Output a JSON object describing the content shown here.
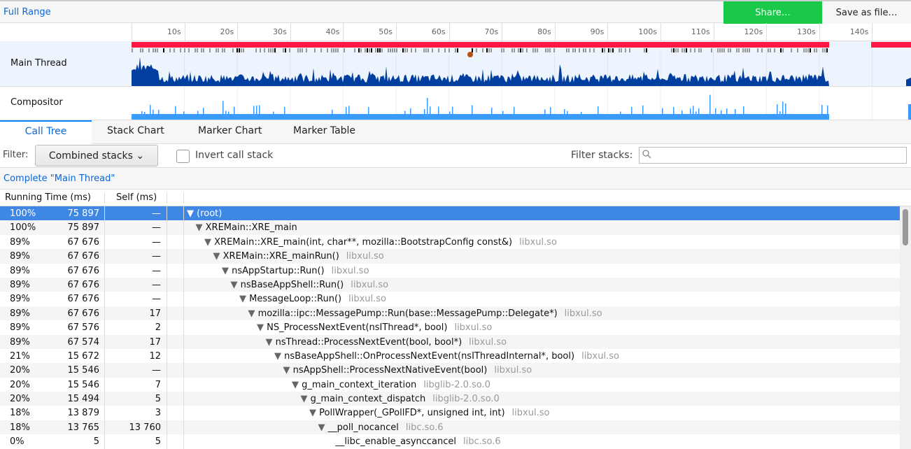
{
  "topbar": {
    "full_range": "Full Range",
    "share": "Share…",
    "save": "Save as file…"
  },
  "timeline": {
    "ticks": [
      "10s",
      "20s",
      "30s",
      "40s",
      "50s",
      "60s",
      "70s",
      "80s",
      "90s",
      "100s",
      "110s",
      "120s",
      "130s",
      "140s"
    ],
    "tracks": [
      {
        "label": "Main Thread"
      },
      {
        "label": "Compositor"
      }
    ]
  },
  "colors": {
    "accent": "#0a84ff",
    "share": "#1bc94a",
    "selected_row": "#3f87e5",
    "cpu_graph": "#003ea0",
    "compositor_graph": "#3b9cff",
    "markers": "#ff1744"
  },
  "tabs": [
    "Call Tree",
    "Stack Chart",
    "Marker Chart",
    "Marker Table"
  ],
  "filter": {
    "label": "Filter:",
    "select": "Combined stacks",
    "invert": "Invert call stack",
    "invert_checked": false,
    "filter_stacks_label": "Filter stacks:",
    "filter_stacks_value": ""
  },
  "breadcrumb": "Complete \"Main Thread\"",
  "columns": {
    "running": "Running Time (ms)",
    "self": "Self (ms)"
  },
  "rows": [
    {
      "pct": "100%",
      "ms": "75 897",
      "self": "—",
      "name": "(root)",
      "lib": "",
      "depth": 0,
      "open": true
    },
    {
      "pct": "100%",
      "ms": "75 897",
      "self": "—",
      "name": "XREMain::XRE_main",
      "lib": "",
      "depth": 1,
      "open": true
    },
    {
      "pct": "89%",
      "ms": "67 676",
      "self": "—",
      "name": "XREMain::XRE_main(int, char**, mozilla::BootstrapConfig const&)",
      "lib": "libxul.so",
      "depth": 2,
      "open": true
    },
    {
      "pct": "89%",
      "ms": "67 676",
      "self": "—",
      "name": "XREMain::XRE_mainRun()",
      "lib": "libxul.so",
      "depth": 3,
      "open": true
    },
    {
      "pct": "89%",
      "ms": "67 676",
      "self": "—",
      "name": "nsAppStartup::Run()",
      "lib": "libxul.so",
      "depth": 4,
      "open": true
    },
    {
      "pct": "89%",
      "ms": "67 676",
      "self": "—",
      "name": "nsBaseAppShell::Run()",
      "lib": "libxul.so",
      "depth": 5,
      "open": true
    },
    {
      "pct": "89%",
      "ms": "67 676",
      "self": "—",
      "name": "MessageLoop::Run()",
      "lib": "libxul.so",
      "depth": 6,
      "open": true
    },
    {
      "pct": "89%",
      "ms": "67 676",
      "self": "17",
      "name": "mozilla::ipc::MessagePump::Run(base::MessagePump::Delegate*)",
      "lib": "libxul.so",
      "depth": 7,
      "open": true
    },
    {
      "pct": "89%",
      "ms": "67 576",
      "self": "2",
      "name": "NS_ProcessNextEvent(nsIThread*, bool)",
      "lib": "libxul.so",
      "depth": 8,
      "open": true
    },
    {
      "pct": "89%",
      "ms": "67 574",
      "self": "17",
      "name": "nsThread::ProcessNextEvent(bool, bool*)",
      "lib": "libxul.so",
      "depth": 9,
      "open": true
    },
    {
      "pct": "21%",
      "ms": "15 672",
      "self": "12",
      "name": "nsBaseAppShell::OnProcessNextEvent(nsIThreadInternal*, bool)",
      "lib": "libxul.so",
      "depth": 10,
      "open": true
    },
    {
      "pct": "20%",
      "ms": "15 546",
      "self": "—",
      "name": "nsAppShell::ProcessNextNativeEvent(bool)",
      "lib": "libxul.so",
      "depth": 11,
      "open": true
    },
    {
      "pct": "20%",
      "ms": "15 546",
      "self": "7",
      "name": "g_main_context_iteration",
      "lib": "libglib-2.0.so.0",
      "depth": 12,
      "open": true
    },
    {
      "pct": "20%",
      "ms": "15 494",
      "self": "5",
      "name": "g_main_context_dispatch",
      "lib": "libglib-2.0.so.0",
      "depth": 13,
      "open": true
    },
    {
      "pct": "18%",
      "ms": "13 879",
      "self": "3",
      "name": "PollWrapper(_GPollFD*, unsigned int, int)",
      "lib": "libxul.so",
      "depth": 14,
      "open": true
    },
    {
      "pct": "18%",
      "ms": "13 765",
      "self": "13 760",
      "name": "__poll_nocancel",
      "lib": "libc.so.6",
      "depth": 15,
      "open": true
    },
    {
      "pct": "0%",
      "ms": "5",
      "self": "5",
      "name": "__libc_enable_asynccancel",
      "lib": "libc.so.6",
      "depth": 16,
      "open": false
    }
  ]
}
